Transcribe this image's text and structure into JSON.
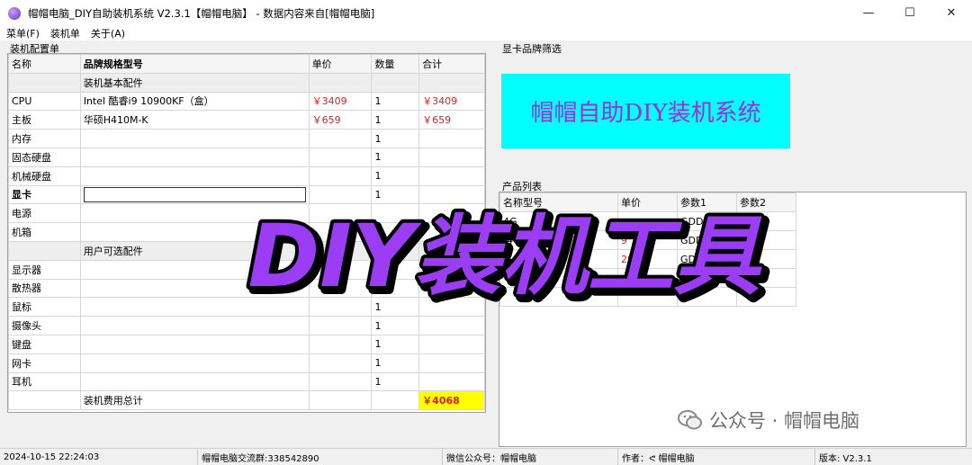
{
  "window": {
    "title": "帽帽电脑_DIY自助装机系统  V2.3.1【帽帽电脑】 - 数据内容来自[帽帽电脑]",
    "minimize": "—",
    "maximize": "☐",
    "close": "✕"
  },
  "menu": [
    "菜单(F)",
    "装机单",
    "关于(A)"
  ],
  "config": {
    "group_label": "装机配置单",
    "headers": [
      "名称",
      "品牌规格型号",
      "单价",
      "数量",
      "合计"
    ],
    "section_basic": "装机基本配件",
    "section_optional": "用户可选配件",
    "rows_basic": [
      {
        "name": "CPU",
        "model": "Intel 酷睿i9 10900KF（盒）",
        "price": "￥3409",
        "qty": "1",
        "total": "￥3409"
      },
      {
        "name": "主板",
        "model": "华硕H410M-K",
        "price": "￥659",
        "qty": "1",
        "total": "￥659"
      },
      {
        "name": "内存",
        "model": "",
        "price": "",
        "qty": "1",
        "total": ""
      },
      {
        "name": "固态硬盘",
        "model": "",
        "price": "",
        "qty": "1",
        "total": ""
      },
      {
        "name": "机械硬盘",
        "model": "",
        "price": "",
        "qty": "1",
        "total": ""
      },
      {
        "name": "显卡",
        "model": "",
        "price": "",
        "qty": "1",
        "total": "",
        "selected": true
      },
      {
        "name": "电源",
        "model": "",
        "price": "",
        "qty": "",
        "total": ""
      },
      {
        "name": "机箱",
        "model": "",
        "price": "",
        "qty": "",
        "total": ""
      }
    ],
    "rows_optional": [
      {
        "name": "显示器",
        "model": "",
        "price": "",
        "qty": "1",
        "total": ""
      },
      {
        "name": "散热器",
        "model": "",
        "price": "",
        "qty": "1",
        "total": ""
      },
      {
        "name": "鼠标",
        "model": "",
        "price": "",
        "qty": "1",
        "total": ""
      },
      {
        "name": "摄像头",
        "model": "",
        "price": "",
        "qty": "1",
        "total": ""
      },
      {
        "name": "键盘",
        "model": "",
        "price": "",
        "qty": "1",
        "total": ""
      },
      {
        "name": "网卡",
        "model": "",
        "price": "",
        "qty": "1",
        "total": ""
      },
      {
        "name": "耳机",
        "model": "",
        "price": "",
        "qty": "1",
        "total": ""
      }
    ],
    "total_label": "装机费用总计",
    "total_value": "￥4068"
  },
  "brand_filter": {
    "group_label": "显卡品牌筛选",
    "banner_text": "帽帽自助DIY装机系统"
  },
  "products": {
    "group_label": "产品列表",
    "headers": [
      "名称型号",
      "单价",
      "参数1",
      "参数2"
    ],
    "rows": [
      {
        "name": "4G",
        "price": "",
        "p1": "GDDR",
        "p2": "B"
      },
      {
        "name": "-4G",
        "price": "9",
        "p1": "GDD",
        "p2": "GB"
      },
      {
        "name": "super",
        "price": "29",
        "p1": "GD",
        "p2": "GB"
      },
      {
        "name": "",
        "price": "",
        "p1": "",
        "p2": "GB"
      },
      {
        "name": "",
        "price": "",
        "p1": "",
        "p2": ""
      }
    ]
  },
  "overlay_text": "DIY装机工具",
  "watermark": "公众号 · 帽帽电脑",
  "status": {
    "datetime": "2024-10-15 22:24:03",
    "qq_group": "帽帽电脑交流群:338542890",
    "wechat": "微信公众号：帽帽电脑",
    "author": "作者：ᕙ 帽帽电脑",
    "version": "版本: V2.3.1"
  },
  "colors": {
    "banner_bg": "#00ffff",
    "banner_text": "#9b30d9",
    "price_red": "#e02020",
    "total_bg": "#ffff00",
    "overlay_fill": "#9b3df5"
  }
}
